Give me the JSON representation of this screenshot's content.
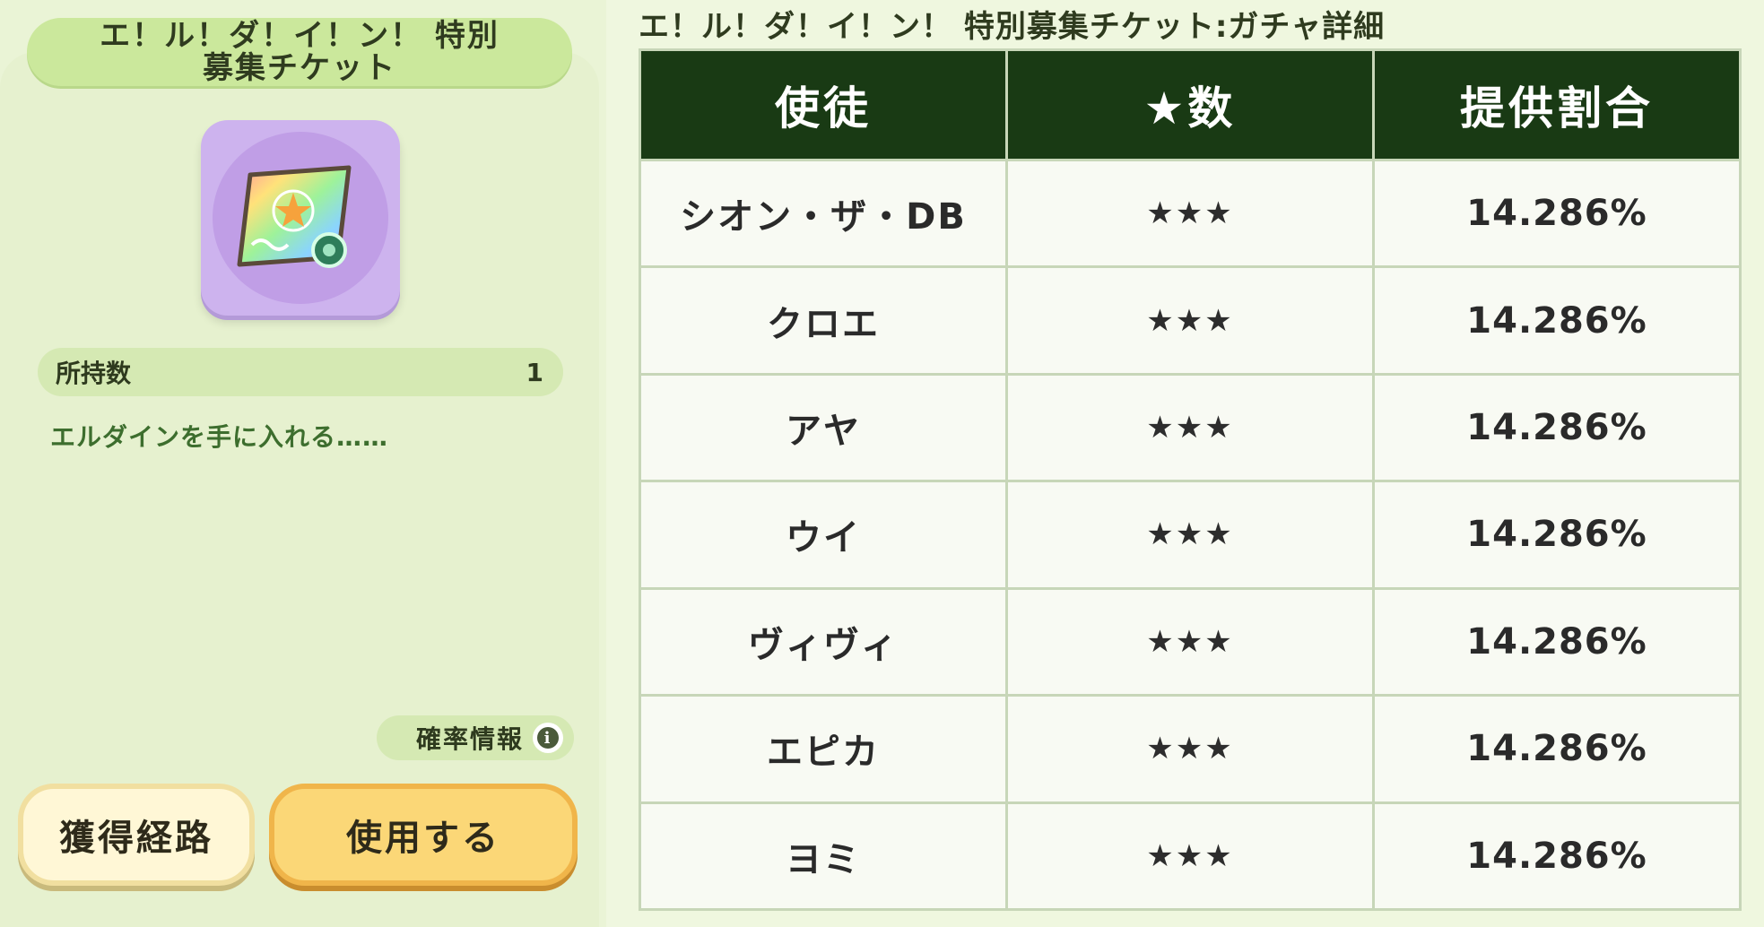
{
  "ticket": {
    "title": "エ！ル！ダ！イ！ン！ 特別募集チケット",
    "count_label": "所持数",
    "count_value": "1",
    "description": "エルダインを手に入れる……",
    "probability_label": "確率情報",
    "info_icon_glyph": "i",
    "buttons": {
      "route": "獲得経路",
      "use": "使用する"
    },
    "icon": "rainbow-ticket-icon"
  },
  "details": {
    "title": "エ！ル！ダ！イ！ン！ 特別募集チケット:ガチャ詳細",
    "columns": [
      "使徒",
      "★数",
      "提供割合"
    ],
    "rows": [
      {
        "name": "シオン・ザ・DB",
        "stars": "★★★",
        "rate": "14.286%"
      },
      {
        "name": "クロエ",
        "stars": "★★★",
        "rate": "14.286%"
      },
      {
        "name": "アヤ",
        "stars": "★★★",
        "rate": "14.286%"
      },
      {
        "name": "ウイ",
        "stars": "★★★",
        "rate": "14.286%"
      },
      {
        "name": "ヴィヴィ",
        "stars": "★★★",
        "rate": "14.286%"
      },
      {
        "name": "エピカ",
        "stars": "★★★",
        "rate": "14.286%"
      },
      {
        "name": "ヨミ",
        "stars": "★★★",
        "rate": "14.286%"
      }
    ]
  },
  "colors": {
    "header_bg": "#193a14",
    "banner_bg": "#cbe89c",
    "use_button": "#fbd777",
    "item_frame": "#cdb3ee"
  }
}
